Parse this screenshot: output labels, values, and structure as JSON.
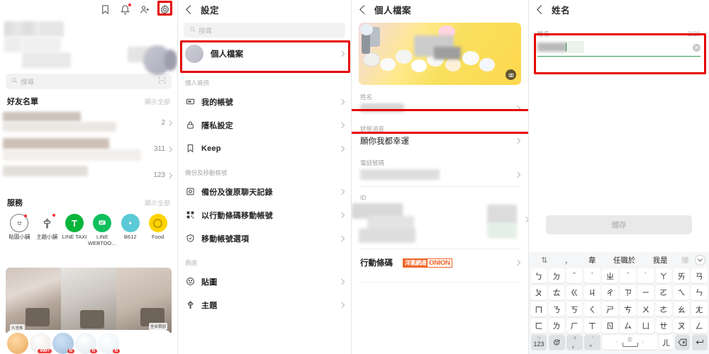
{
  "panel_friends": {
    "top_icons": [
      {
        "name": "bookmark-icon",
        "badge": false
      },
      {
        "name": "bell-icon",
        "badge": true
      },
      {
        "name": "add-friend-icon",
        "badge": false
      },
      {
        "name": "gear-icon",
        "badge": false,
        "highlighted": true
      }
    ],
    "search": {
      "placeholder": "搜尋",
      "icon": "search-icon",
      "right_icon": "scan-icon"
    },
    "friends_section": {
      "title": "好友名單",
      "more_label": "顯示全部"
    },
    "friend_rows": [
      {
        "count": "2"
      },
      {
        "count": "311"
      },
      {
        "count": "123"
      }
    ],
    "services_section": {
      "title": "服務",
      "more_label": "顯示全部"
    },
    "services": [
      {
        "label": "貼圖小舖",
        "icon": "sticker-shop-icon",
        "badge": true,
        "color": "#ffffff"
      },
      {
        "label": "主題小舖",
        "icon": "theme-shop-icon",
        "badge": true,
        "color": "#ffffff"
      },
      {
        "label": "LINE TAXI",
        "icon": "taxi-icon",
        "badge": false,
        "color": "#07b53b"
      },
      {
        "label": "LINE WEBTOO…",
        "icon": "webtoon-icon",
        "badge": false,
        "color": "#0fbf5c"
      },
      {
        "label": "B612",
        "icon": "b612-icon",
        "badge": false,
        "color": "#5bc9d6"
      },
      {
        "label": "Food",
        "icon": "food-icon",
        "badge": false,
        "color": "#ffd400"
      }
    ],
    "ad": {
      "stickers_badges": [
        "999+",
        "N",
        "N",
        "N"
      ],
      "tag1": "久坐族",
      "tag2": "全台首創"
    }
  },
  "panel_settings": {
    "nav_title": "設定",
    "search_placeholder": "搜尋",
    "profile_row": {
      "label": "個人檔案",
      "highlighted": true
    },
    "groups": [
      {
        "label": "個人資訊",
        "items": [
          {
            "label": "我的帳號",
            "icon": "account-card-icon"
          },
          {
            "label": "隱私設定",
            "icon": "lock-icon"
          },
          {
            "label": "Keep",
            "icon": "bookmark-icon"
          }
        ]
      },
      {
        "label": "備份及移動帳號",
        "items": [
          {
            "label": "備份及復原聊天記錄",
            "icon": "backup-icon"
          },
          {
            "label": "以行動條碼移動帳號",
            "icon": "qrcode-icon"
          },
          {
            "label": "移動帳號選項",
            "icon": "shield-icon"
          }
        ]
      },
      {
        "label": "商店",
        "items": [
          {
            "label": "貼圖",
            "icon": "sticker-icon"
          },
          {
            "label": "主題",
            "icon": "theme-icon"
          }
        ]
      }
    ]
  },
  "panel_profile": {
    "nav_title": "個人檔案",
    "cover": {
      "camera_button": "camera-icon"
    },
    "fields": [
      {
        "label": "姓名",
        "value": "",
        "blurred": true,
        "highlighted": true
      },
      {
        "label": "狀態消息",
        "value": "願你我都幸運",
        "blurred": false,
        "highlighted": false
      },
      {
        "label": "電話號碼",
        "value": "",
        "blurred": true,
        "highlighted": false
      },
      {
        "label": "ID",
        "value": "",
        "blurred": true,
        "highlighted": false
      }
    ],
    "barcode_row": {
      "label": "行動條碼",
      "brand_left": "洋蔥網通",
      "brand_right": "ONION"
    }
  },
  "panel_name_edit": {
    "nav_title": "姓名",
    "field": {
      "label": "姓名",
      "counter": "2/20",
      "value": "",
      "clear_icon": "clear-circle-icon",
      "highlighted": true
    },
    "save_label": "儲存",
    "keyboard": {
      "candidates": [
        "⇅",
        "，",
        "韋",
        "任職於",
        "我是",
        "賺"
      ],
      "collapse_icon": "chevron-down-icon",
      "rows": [
        [
          "ㄅ",
          "ㄉ",
          "ˇ",
          "ˋ",
          "ㄓ",
          "ˊ",
          "˙",
          "ㄚ",
          "ㄞ",
          "ㄢ"
        ],
        [
          "ㄆ",
          "ㄊ",
          "ㄍ",
          "ㄐ",
          "ㄔ",
          "ㄗ",
          "ㄧ",
          "ㄛ",
          "ㄟ",
          "ㄣ"
        ],
        [
          "ㄇ",
          "ㄋ",
          "ㄎ",
          "ㄑ",
          "ㄕ",
          "ㄘ",
          "ㄨ",
          "ㄜ",
          "ㄠ",
          "ㄤ"
        ],
        [
          "ㄈ",
          "ㄌ",
          "ㄏ",
          "ㄒ",
          "ㄖ",
          "ㄙ",
          "ㄩ",
          "ㄝ",
          "ㄡ",
          "ㄥ"
        ]
      ],
      "bottom": {
        "num_key_top": "ㄅ",
        "num_key": "123",
        "emoji": "emoji-icon",
        "comma_top": "mic-icon",
        "comma": "，",
        "period_top": "”",
        "period": "。",
        "space_label": "繁",
        "er_key": "ㄦ",
        "backspace": "backspace-icon",
        "enter": "enter-icon"
      }
    }
  },
  "colors": {
    "highlight_red": "#e60000",
    "line_green": "#06c755",
    "underline_green": "#2f9e4f",
    "onion_orange": "#f0652a"
  }
}
